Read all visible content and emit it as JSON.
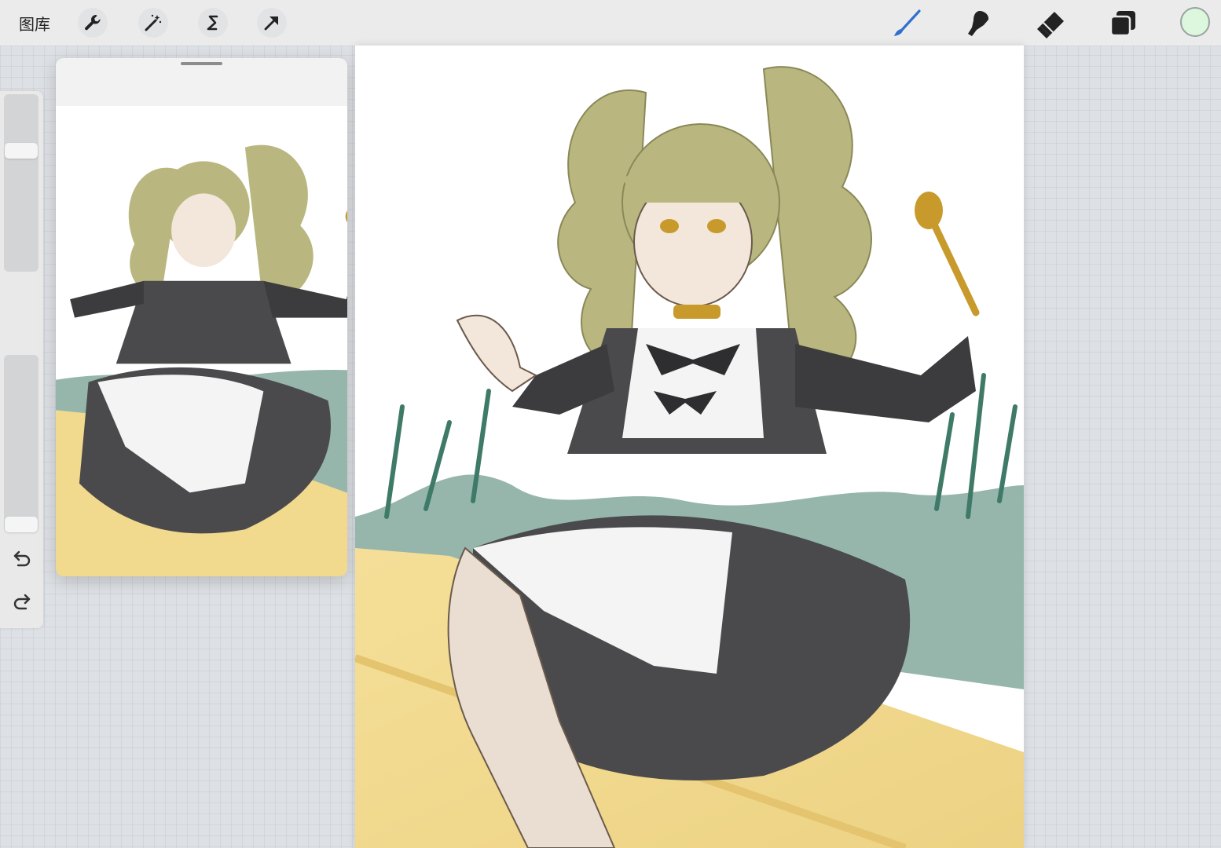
{
  "toolbar": {
    "gallery_label": "图库",
    "left_tools": [
      {
        "name": "actions",
        "icon": "wrench-icon"
      },
      {
        "name": "adjustments",
        "icon": "magic-wand-icon"
      },
      {
        "name": "selection",
        "icon": "selection-s-icon"
      },
      {
        "name": "transform",
        "icon": "arrow-cursor-icon"
      }
    ],
    "right_tools": [
      {
        "name": "brush",
        "icon": "brush-icon",
        "active": true
      },
      {
        "name": "smudge",
        "icon": "smudge-finger-icon"
      },
      {
        "name": "eraser",
        "icon": "eraser-icon"
      },
      {
        "name": "layers",
        "icon": "layers-icon"
      }
    ],
    "current_color": "#dcf7dd",
    "active_color": "#2f6fcf"
  },
  "sidebar": {
    "brush_size_level": 0.7,
    "opacity_level": 0.0,
    "modify_icon": "square-modify-icon",
    "undo_icon": "undo-arrow-icon",
    "redo_icon": "redo-arrow-icon"
  },
  "reference": {
    "handle_icon": "drag-handle-icon"
  },
  "artwork": {
    "hair_color": "#b9b77f",
    "dress_color": "#4a4a4c",
    "apron_color": "#f4f4f4",
    "grass_color": "#3f7a68",
    "bench_color": "#f1d98d",
    "spoon_color": "#c89a2c"
  }
}
